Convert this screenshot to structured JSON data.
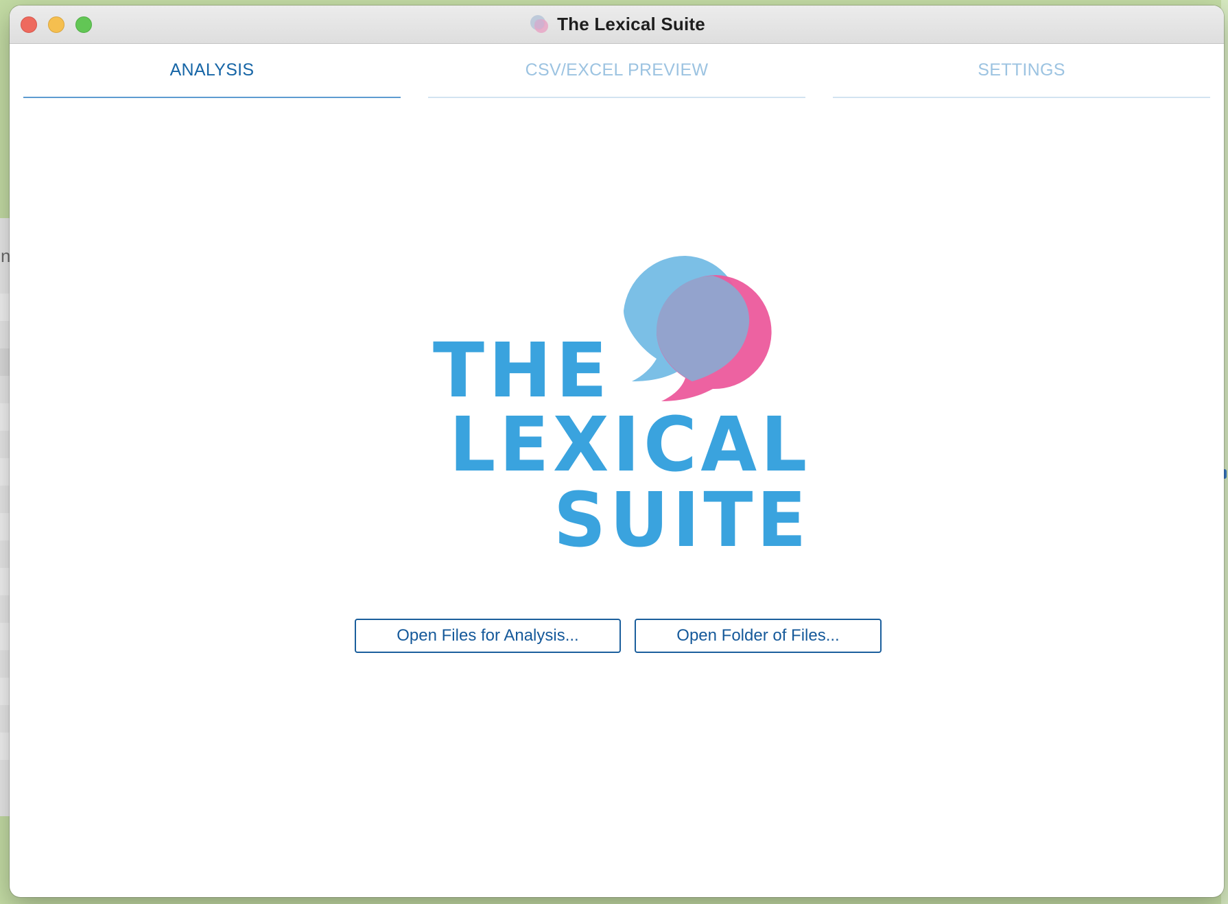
{
  "window": {
    "title": "The Lexical Suite",
    "app_icon": "speech-bubbles-icon"
  },
  "tabs": [
    {
      "label": "ANALYSIS",
      "active": true
    },
    {
      "label": "CSV/EXCEL PREVIEW",
      "active": false
    },
    {
      "label": "SETTINGS",
      "active": false
    }
  ],
  "logo": {
    "line1": "THE",
    "line2": "LEXICAL",
    "line3": "SUITE",
    "colors": {
      "text": "#3aa3de",
      "bubble_blue": "#7bbfe6",
      "bubble_pink": "#ec5a9c",
      "overlap": "#93a3cd"
    }
  },
  "buttons": {
    "open_files": "Open Files for Analysis...",
    "open_folder": "Open Folder of Files..."
  },
  "background_window": {
    "peek_glyph": "n"
  },
  "colors": {
    "accent": "#1665a6",
    "inactive_tab": "#9cc3e1",
    "desktop": "#c3dba4"
  }
}
